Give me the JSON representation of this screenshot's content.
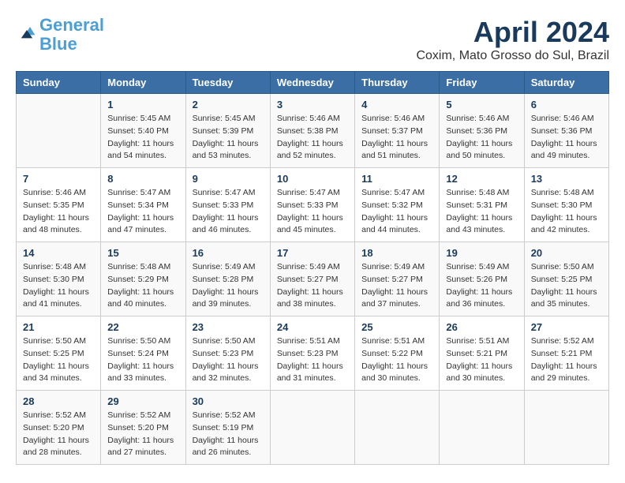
{
  "header": {
    "logo_line1": "General",
    "logo_line2": "Blue",
    "title": "April 2024",
    "location": "Coxim, Mato Grosso do Sul, Brazil"
  },
  "columns": [
    "Sunday",
    "Monday",
    "Tuesday",
    "Wednesday",
    "Thursday",
    "Friday",
    "Saturday"
  ],
  "weeks": [
    [
      {
        "day": "",
        "info": ""
      },
      {
        "day": "1",
        "info": "Sunrise: 5:45 AM\nSunset: 5:40 PM\nDaylight: 11 hours\nand 54 minutes."
      },
      {
        "day": "2",
        "info": "Sunrise: 5:45 AM\nSunset: 5:39 PM\nDaylight: 11 hours\nand 53 minutes."
      },
      {
        "day": "3",
        "info": "Sunrise: 5:46 AM\nSunset: 5:38 PM\nDaylight: 11 hours\nand 52 minutes."
      },
      {
        "day": "4",
        "info": "Sunrise: 5:46 AM\nSunset: 5:37 PM\nDaylight: 11 hours\nand 51 minutes."
      },
      {
        "day": "5",
        "info": "Sunrise: 5:46 AM\nSunset: 5:36 PM\nDaylight: 11 hours\nand 50 minutes."
      },
      {
        "day": "6",
        "info": "Sunrise: 5:46 AM\nSunset: 5:36 PM\nDaylight: 11 hours\nand 49 minutes."
      }
    ],
    [
      {
        "day": "7",
        "info": "Sunrise: 5:46 AM\nSunset: 5:35 PM\nDaylight: 11 hours\nand 48 minutes."
      },
      {
        "day": "8",
        "info": "Sunrise: 5:47 AM\nSunset: 5:34 PM\nDaylight: 11 hours\nand 47 minutes."
      },
      {
        "day": "9",
        "info": "Sunrise: 5:47 AM\nSunset: 5:33 PM\nDaylight: 11 hours\nand 46 minutes."
      },
      {
        "day": "10",
        "info": "Sunrise: 5:47 AM\nSunset: 5:33 PM\nDaylight: 11 hours\nand 45 minutes."
      },
      {
        "day": "11",
        "info": "Sunrise: 5:47 AM\nSunset: 5:32 PM\nDaylight: 11 hours\nand 44 minutes."
      },
      {
        "day": "12",
        "info": "Sunrise: 5:48 AM\nSunset: 5:31 PM\nDaylight: 11 hours\nand 43 minutes."
      },
      {
        "day": "13",
        "info": "Sunrise: 5:48 AM\nSunset: 5:30 PM\nDaylight: 11 hours\nand 42 minutes."
      }
    ],
    [
      {
        "day": "14",
        "info": "Sunrise: 5:48 AM\nSunset: 5:30 PM\nDaylight: 11 hours\nand 41 minutes."
      },
      {
        "day": "15",
        "info": "Sunrise: 5:48 AM\nSunset: 5:29 PM\nDaylight: 11 hours\nand 40 minutes."
      },
      {
        "day": "16",
        "info": "Sunrise: 5:49 AM\nSunset: 5:28 PM\nDaylight: 11 hours\nand 39 minutes."
      },
      {
        "day": "17",
        "info": "Sunrise: 5:49 AM\nSunset: 5:27 PM\nDaylight: 11 hours\nand 38 minutes."
      },
      {
        "day": "18",
        "info": "Sunrise: 5:49 AM\nSunset: 5:27 PM\nDaylight: 11 hours\nand 37 minutes."
      },
      {
        "day": "19",
        "info": "Sunrise: 5:49 AM\nSunset: 5:26 PM\nDaylight: 11 hours\nand 36 minutes."
      },
      {
        "day": "20",
        "info": "Sunrise: 5:50 AM\nSunset: 5:25 PM\nDaylight: 11 hours\nand 35 minutes."
      }
    ],
    [
      {
        "day": "21",
        "info": "Sunrise: 5:50 AM\nSunset: 5:25 PM\nDaylight: 11 hours\nand 34 minutes."
      },
      {
        "day": "22",
        "info": "Sunrise: 5:50 AM\nSunset: 5:24 PM\nDaylight: 11 hours\nand 33 minutes."
      },
      {
        "day": "23",
        "info": "Sunrise: 5:50 AM\nSunset: 5:23 PM\nDaylight: 11 hours\nand 32 minutes."
      },
      {
        "day": "24",
        "info": "Sunrise: 5:51 AM\nSunset: 5:23 PM\nDaylight: 11 hours\nand 31 minutes."
      },
      {
        "day": "25",
        "info": "Sunrise: 5:51 AM\nSunset: 5:22 PM\nDaylight: 11 hours\nand 30 minutes."
      },
      {
        "day": "26",
        "info": "Sunrise: 5:51 AM\nSunset: 5:21 PM\nDaylight: 11 hours\nand 30 minutes."
      },
      {
        "day": "27",
        "info": "Sunrise: 5:52 AM\nSunset: 5:21 PM\nDaylight: 11 hours\nand 29 minutes."
      }
    ],
    [
      {
        "day": "28",
        "info": "Sunrise: 5:52 AM\nSunset: 5:20 PM\nDaylight: 11 hours\nand 28 minutes."
      },
      {
        "day": "29",
        "info": "Sunrise: 5:52 AM\nSunset: 5:20 PM\nDaylight: 11 hours\nand 27 minutes."
      },
      {
        "day": "30",
        "info": "Sunrise: 5:52 AM\nSunset: 5:19 PM\nDaylight: 11 hours\nand 26 minutes."
      },
      {
        "day": "",
        "info": ""
      },
      {
        "day": "",
        "info": ""
      },
      {
        "day": "",
        "info": ""
      },
      {
        "day": "",
        "info": ""
      }
    ]
  ]
}
